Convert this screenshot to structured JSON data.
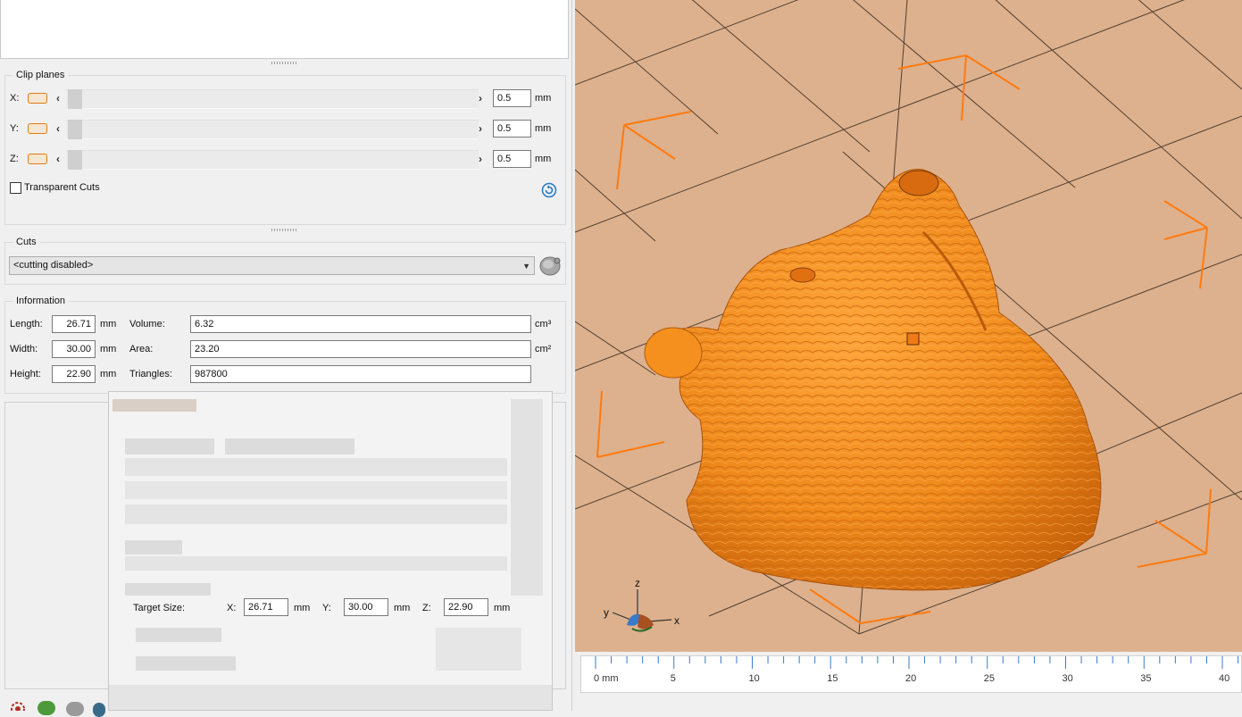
{
  "clip_planes": {
    "title": "Clip planes",
    "rows": [
      {
        "axis": "X:",
        "value": "0.5",
        "unit": "mm"
      },
      {
        "axis": "Y:",
        "value": "0.5",
        "unit": "mm"
      },
      {
        "axis": "Z:",
        "value": "0.5",
        "unit": "mm"
      }
    ],
    "transparent_cuts_label": "Transparent Cuts",
    "transparent_cuts_checked": false
  },
  "cuts": {
    "title": "Cuts",
    "selected": "<cutting disabled>"
  },
  "information": {
    "title": "Information",
    "length_label": "Length:",
    "length_value": "26.71",
    "width_label": "Width:",
    "width_value": "30.00",
    "height_label": "Height:",
    "height_value": "22.90",
    "mm_unit": "mm",
    "volume_label": "Volume:",
    "volume_value": "6.32",
    "volume_unit": "cm³",
    "area_label": "Area:",
    "area_value": "23.20",
    "area_unit": "cm²",
    "triangles_label": "Triangles:",
    "triangles_value": "987800"
  },
  "scale_dialog": {
    "target_size_label": "Target Size:",
    "x_label": "X:",
    "x_value": "26.71",
    "y_label": "Y:",
    "y_value": "30.00",
    "z_label": "Z:",
    "z_value": "22.90",
    "unit": "mm"
  },
  "viewport": {
    "model_color": "#f08a1c",
    "bed_color": "#ddb18d",
    "axis_labels": {
      "z": "z",
      "y": "y",
      "x": "x"
    }
  },
  "ruler": {
    "labels": [
      "0 mm",
      "5",
      "10",
      "15",
      "20",
      "25",
      "30",
      "35",
      "40"
    ]
  },
  "colors": {
    "accent_orange": "#e07a10",
    "panel_bg": "#f0f0f0"
  }
}
